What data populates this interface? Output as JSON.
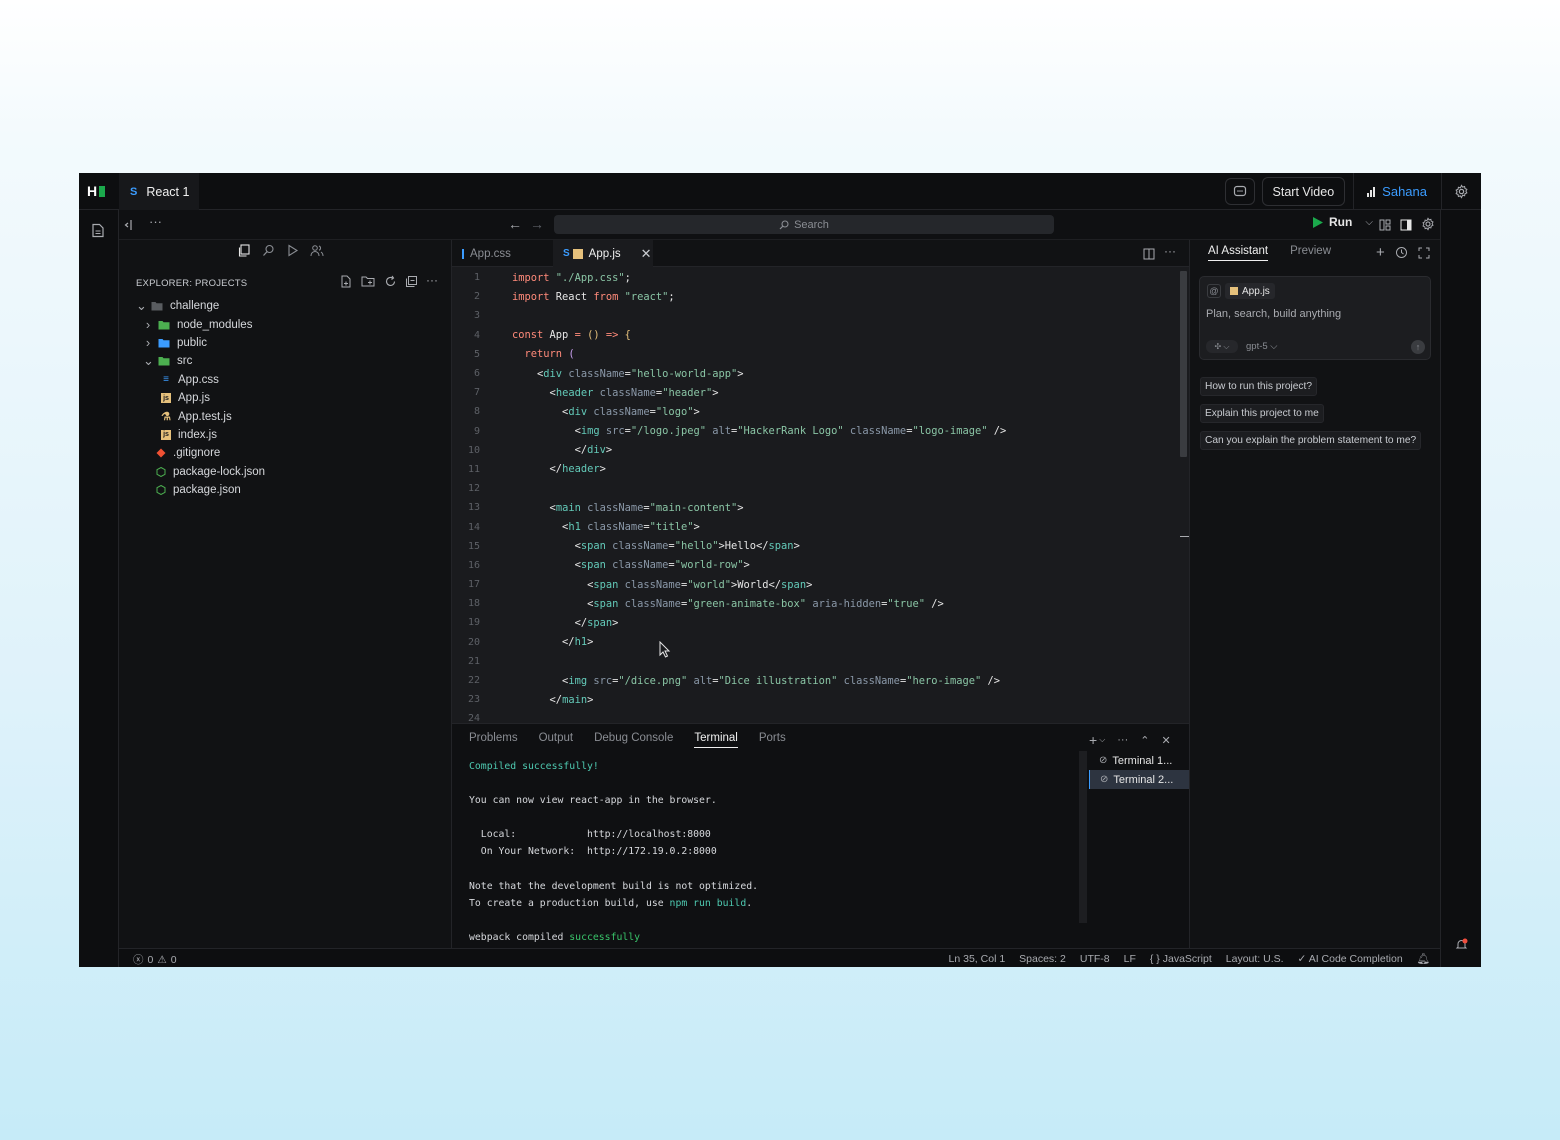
{
  "titlebar": {
    "project_prefix": "S",
    "project_name": "React 1",
    "start_video": "Start Video",
    "user_name": "Sahana"
  },
  "toolbar": {
    "search_placeholder": "Search",
    "run_label": "Run"
  },
  "sidebar": {
    "header": "EXPLORER: PROJECTS",
    "tree": [
      {
        "label": "challenge",
        "kind": "folder-open",
        "depth": 0
      },
      {
        "label": "node_modules",
        "kind": "folder",
        "depth": 1,
        "color": "#4caf50"
      },
      {
        "label": "public",
        "kind": "folder",
        "depth": 1,
        "color": "#3b9cff"
      },
      {
        "label": "src",
        "kind": "folder-open",
        "depth": 1,
        "color": "#4caf50"
      },
      {
        "label": "App.css",
        "kind": "css",
        "depth": 2
      },
      {
        "label": "App.js",
        "kind": "js",
        "depth": 2
      },
      {
        "label": "App.test.js",
        "kind": "test",
        "depth": 2
      },
      {
        "label": "index.js",
        "kind": "js",
        "depth": 2
      },
      {
        "label": ".gitignore",
        "kind": "git",
        "depth": 1
      },
      {
        "label": "package-lock.json",
        "kind": "json",
        "depth": 1
      },
      {
        "label": "package.json",
        "kind": "json",
        "depth": 1
      }
    ]
  },
  "editor": {
    "tabs": [
      {
        "label": "App.css",
        "active": false
      },
      {
        "label": "App.js",
        "prefix": "S",
        "active": true
      }
    ],
    "lines": [
      [
        [
          "k",
          "import "
        ],
        [
          "s",
          "\"./App.css\""
        ],
        [
          "w",
          ";"
        ]
      ],
      [
        [
          "k",
          "import "
        ],
        [
          "w",
          "React "
        ],
        [
          "k",
          "from "
        ],
        [
          "s",
          "\"react\""
        ],
        [
          "w",
          ";"
        ]
      ],
      [],
      [
        [
          "k",
          "const "
        ],
        [
          "p",
          "App "
        ],
        [
          "k",
          "= "
        ],
        [
          "y",
          "() "
        ],
        [
          "k",
          "=> "
        ],
        [
          "y",
          "{"
        ]
      ],
      [
        [
          "w",
          "  "
        ],
        [
          "k",
          "return "
        ],
        [
          "pu",
          "("
        ]
      ],
      [
        [
          "w",
          "    "
        ],
        [
          "w",
          "<"
        ],
        [
          "a",
          "div "
        ],
        [
          "t",
          "className"
        ],
        [
          "w",
          "="
        ],
        [
          "s",
          "\"hello-world-app\""
        ],
        [
          "w",
          ">"
        ]
      ],
      [
        [
          "w",
          "      "
        ],
        [
          "w",
          "<"
        ],
        [
          "a",
          "header "
        ],
        [
          "t",
          "className"
        ],
        [
          "w",
          "="
        ],
        [
          "s",
          "\"header\""
        ],
        [
          "w",
          ">"
        ]
      ],
      [
        [
          "w",
          "        "
        ],
        [
          "w",
          "<"
        ],
        [
          "a",
          "div "
        ],
        [
          "t",
          "className"
        ],
        [
          "w",
          "="
        ],
        [
          "s",
          "\"logo\""
        ],
        [
          "w",
          ">"
        ]
      ],
      [
        [
          "w",
          "          "
        ],
        [
          "w",
          "<"
        ],
        [
          "a",
          "img "
        ],
        [
          "t",
          "src"
        ],
        [
          "w",
          "="
        ],
        [
          "s",
          "\"/logo.jpeg\" "
        ],
        [
          "t",
          "alt"
        ],
        [
          "w",
          "="
        ],
        [
          "s",
          "\"HackerRank Logo\" "
        ],
        [
          "t",
          "className"
        ],
        [
          "w",
          "="
        ],
        [
          "s",
          "\"logo-image\""
        ],
        [
          "w",
          " />"
        ]
      ],
      [
        [
          "w",
          "          "
        ],
        [
          "w",
          "</"
        ],
        [
          "a",
          "div"
        ],
        [
          "w",
          ">"
        ]
      ],
      [
        [
          "w",
          "      "
        ],
        [
          "w",
          "</"
        ],
        [
          "a",
          "header"
        ],
        [
          "w",
          ">"
        ]
      ],
      [],
      [
        [
          "w",
          "      "
        ],
        [
          "w",
          "<"
        ],
        [
          "a",
          "main "
        ],
        [
          "t",
          "className"
        ],
        [
          "w",
          "="
        ],
        [
          "s",
          "\"main-content\""
        ],
        [
          "w",
          ">"
        ]
      ],
      [
        [
          "w",
          "        "
        ],
        [
          "w",
          "<"
        ],
        [
          "a",
          "h1 "
        ],
        [
          "t",
          "className"
        ],
        [
          "w",
          "="
        ],
        [
          "s",
          "\"title\""
        ],
        [
          "w",
          ">"
        ]
      ],
      [
        [
          "w",
          "          "
        ],
        [
          "w",
          "<"
        ],
        [
          "a",
          "span "
        ],
        [
          "t",
          "className"
        ],
        [
          "w",
          "="
        ],
        [
          "s",
          "\"hello\""
        ],
        [
          "w",
          ">Hello</"
        ],
        [
          "a",
          "span"
        ],
        [
          "w",
          ">"
        ]
      ],
      [
        [
          "w",
          "          "
        ],
        [
          "w",
          "<"
        ],
        [
          "a",
          "span "
        ],
        [
          "t",
          "className"
        ],
        [
          "w",
          "="
        ],
        [
          "s",
          "\"world-row\""
        ],
        [
          "w",
          ">"
        ]
      ],
      [
        [
          "w",
          "            "
        ],
        [
          "w",
          "<"
        ],
        [
          "a",
          "span "
        ],
        [
          "t",
          "className"
        ],
        [
          "w",
          "="
        ],
        [
          "s",
          "\"world\""
        ],
        [
          "w",
          ">World</"
        ],
        [
          "a",
          "span"
        ],
        [
          "w",
          ">"
        ]
      ],
      [
        [
          "w",
          "            "
        ],
        [
          "w",
          "<"
        ],
        [
          "a",
          "span "
        ],
        [
          "t",
          "className"
        ],
        [
          "w",
          "="
        ],
        [
          "s",
          "\"green-animate-box\" "
        ],
        [
          "t",
          "aria-hidden"
        ],
        [
          "w",
          "="
        ],
        [
          "s",
          "\"true\""
        ],
        [
          "w",
          " />"
        ]
      ],
      [
        [
          "w",
          "          "
        ],
        [
          "w",
          "</"
        ],
        [
          "a",
          "span"
        ],
        [
          "w",
          ">"
        ]
      ],
      [
        [
          "w",
          "        "
        ],
        [
          "w",
          "</"
        ],
        [
          "a",
          "h1"
        ],
        [
          "w",
          ">"
        ]
      ],
      [],
      [
        [
          "w",
          "        "
        ],
        [
          "w",
          "<"
        ],
        [
          "a",
          "img "
        ],
        [
          "t",
          "src"
        ],
        [
          "w",
          "="
        ],
        [
          "s",
          "\"/dice.png\" "
        ],
        [
          "t",
          "alt"
        ],
        [
          "w",
          "="
        ],
        [
          "s",
          "\"Dice illustration\" "
        ],
        [
          "t",
          "className"
        ],
        [
          "w",
          "="
        ],
        [
          "s",
          "\"hero-image\""
        ],
        [
          "w",
          " />"
        ]
      ],
      [
        [
          "w",
          "      "
        ],
        [
          "w",
          "</"
        ],
        [
          "a",
          "main"
        ],
        [
          "w",
          ">"
        ]
      ],
      []
    ]
  },
  "panel": {
    "tabs": [
      "Problems",
      "Output",
      "Debug Console",
      "Terminal",
      "Ports"
    ],
    "active_tab": "Terminal",
    "terminal_lines": [
      [
        [
          "#4ec9b0",
          "Compiled successfully!"
        ]
      ],
      [],
      [
        [
          "#d6d8dc",
          "You can now view "
        ],
        [
          "#d6d8dc",
          "react-app"
        ],
        [
          "#d6d8dc",
          " in the browser."
        ]
      ],
      [],
      [
        [
          "#d6d8dc",
          "  Local:            http://localhost:"
        ],
        [
          "#d6d8dc",
          "8000"
        ]
      ],
      [
        [
          "#d6d8dc",
          "  On Your Network:  http://172.19.0.2:"
        ],
        [
          "#d6d8dc",
          "8000"
        ]
      ],
      [],
      [
        [
          "#d6d8dc",
          "Note that the development build is not optimized."
        ]
      ],
      [
        [
          "#d6d8dc",
          "To create a production build, use "
        ],
        [
          "#4ec9b0",
          "npm run build"
        ],
        [
          "#d6d8dc",
          "."
        ]
      ],
      [],
      [
        [
          "#d6d8dc",
          "webpack compiled "
        ],
        [
          "#39c46a",
          "successfully"
        ]
      ]
    ],
    "terminals": [
      "Terminal 1...",
      "Terminal 2..."
    ]
  },
  "assistant": {
    "tabs": [
      "AI Assistant",
      "Preview"
    ],
    "context_file": "App.js",
    "placeholder": "Plan, search, build anything",
    "model": "gpt-5",
    "suggestions": [
      "How to run this project?",
      "Explain this project to me",
      "Can you explain the problem statement to me?"
    ]
  },
  "statusbar": {
    "errors": "0",
    "warnings": "0",
    "position": "Ln 35, Col 1",
    "spaces": "Spaces: 2",
    "encoding": "UTF-8",
    "eol": "LF",
    "language": "JavaScript",
    "layout": "Layout: U.S.",
    "completion": "AI Code Completion"
  }
}
